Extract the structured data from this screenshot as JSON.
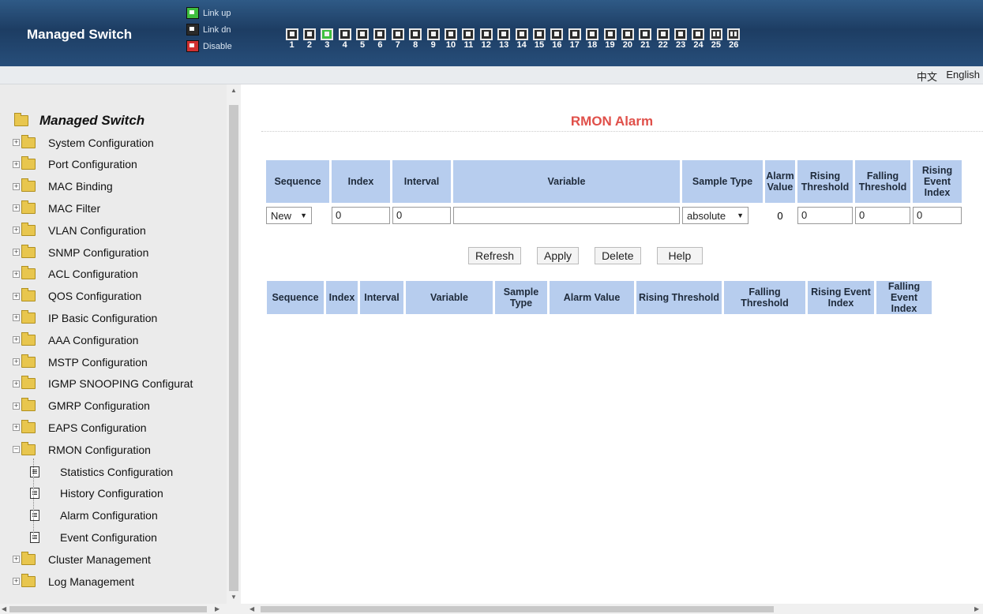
{
  "header": {
    "brand": "Managed Switch",
    "legend": [
      {
        "label": "Link up",
        "color": "#3fbf3f"
      },
      {
        "label": "Link dn",
        "color": "#2a2a2a"
      },
      {
        "label": "Disable",
        "color": "#d03030"
      }
    ],
    "ports": [
      {
        "num": "1",
        "state": "down"
      },
      {
        "num": "2",
        "state": "down"
      },
      {
        "num": "3",
        "state": "up"
      },
      {
        "num": "4",
        "state": "down"
      },
      {
        "num": "5",
        "state": "down"
      },
      {
        "num": "6",
        "state": "down"
      },
      {
        "num": "7",
        "state": "down"
      },
      {
        "num": "8",
        "state": "down"
      },
      {
        "num": "9",
        "state": "down"
      },
      {
        "num": "10",
        "state": "down"
      },
      {
        "num": "11",
        "state": "down"
      },
      {
        "num": "12",
        "state": "down"
      },
      {
        "num": "13",
        "state": "down"
      },
      {
        "num": "14",
        "state": "down"
      },
      {
        "num": "15",
        "state": "down"
      },
      {
        "num": "16",
        "state": "down"
      },
      {
        "num": "17",
        "state": "down"
      },
      {
        "num": "18",
        "state": "down"
      },
      {
        "num": "19",
        "state": "down"
      },
      {
        "num": "20",
        "state": "down"
      },
      {
        "num": "21",
        "state": "down"
      },
      {
        "num": "22",
        "state": "down"
      },
      {
        "num": "23",
        "state": "down"
      },
      {
        "num": "24",
        "state": "down"
      },
      {
        "num": "25",
        "state": "fiber"
      },
      {
        "num": "26",
        "state": "fiber"
      }
    ]
  },
  "langbar": {
    "chinese": "中文",
    "english": "English"
  },
  "sidebar": {
    "title": "Managed Switch",
    "items": [
      "System Configuration",
      "Port Configuration",
      "MAC Binding",
      "MAC Filter",
      "VLAN Configuration",
      "SNMP Configuration",
      "ACL Configuration",
      "QOS Configuration",
      "IP Basic Configuration",
      "AAA Configuration",
      "MSTP Configuration",
      "IGMP SNOOPING Configurat",
      "GMRP Configuration",
      "EAPS Configuration",
      "RMON Configuration"
    ],
    "rmon_children": [
      "Statistics Configuration",
      "History Configuration",
      "Alarm Configuration",
      "Event Configuration"
    ],
    "after_items": [
      "Cluster Management",
      "Log Management"
    ]
  },
  "main": {
    "title": "RMON Alarm",
    "form_headers": {
      "sequence": "Sequence",
      "index": "Index",
      "interval": "Interval",
      "variable": "Variable",
      "sample_type": "Sample Type",
      "alarm_value": "Alarm Value",
      "rising_threshold": "Rising Threshold",
      "falling_threshold": "Falling Threshold",
      "rising_event_index": "Rising Event Index"
    },
    "form_values": {
      "sequence": "New",
      "index": "0",
      "interval": "0",
      "variable": "",
      "sample_type": "absolute",
      "alarm_value": "0",
      "rising_threshold": "0",
      "falling_threshold": "0",
      "rising_event_index": "0"
    },
    "buttons": {
      "refresh": "Refresh",
      "apply": "Apply",
      "delete": "Delete",
      "help": "Help"
    },
    "list_headers": {
      "sequence": "Sequence",
      "index": "Index",
      "interval": "Interval",
      "variable": "Variable",
      "sample_type": "Sample Type",
      "alarm_value": "Alarm Value",
      "rising_threshold": "Rising Threshold",
      "falling_threshold": "Falling Threshold",
      "rising_event_index": "Rising Event Index",
      "falling_event_index": "Falling Event Index"
    }
  }
}
